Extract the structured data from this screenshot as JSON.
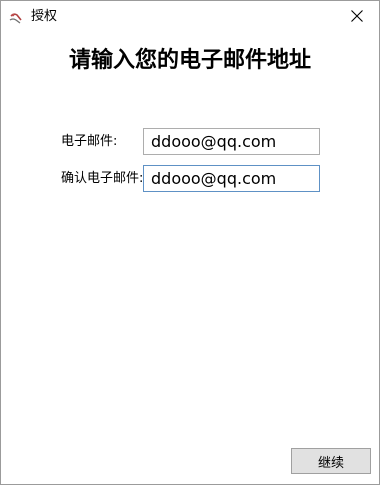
{
  "window": {
    "title": "授权",
    "close_icon": "close-icon",
    "app_icon": "app-logo-icon"
  },
  "main": {
    "heading": "请输入您的电子邮件地址",
    "email": {
      "label": "电子邮件:",
      "value": "ddooo@qq.com"
    },
    "confirm_email": {
      "label": "确认电子邮件:",
      "value": "ddooo@qq.com"
    }
  },
  "footer": {
    "continue_label": "继续"
  },
  "colors": {
    "window_border": "#9b9b9b",
    "input_border": "#adadad",
    "focused_input_border": "#5e91c5",
    "button_bg": "#e1e1e1"
  }
}
